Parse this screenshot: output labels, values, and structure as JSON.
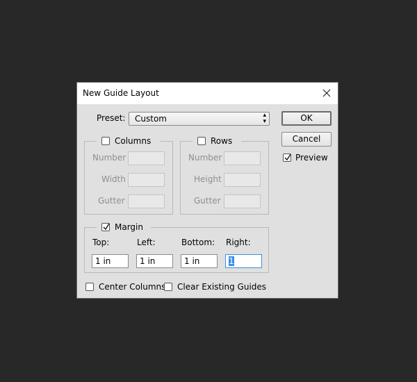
{
  "dialog": {
    "title": "New Guide Layout",
    "close_icon": "close-icon"
  },
  "preset": {
    "label": "Preset:",
    "value": "Custom"
  },
  "buttons": {
    "ok": "OK",
    "cancel": "Cancel"
  },
  "preview": {
    "label": "Preview",
    "checked": true
  },
  "columns": {
    "label": "Columns",
    "checked": false,
    "fields": [
      {
        "label": "Number",
        "value": ""
      },
      {
        "label": "Width",
        "value": ""
      },
      {
        "label": "Gutter",
        "value": ""
      }
    ]
  },
  "rows": {
    "label": "Rows",
    "checked": false,
    "fields": [
      {
        "label": "Number",
        "value": ""
      },
      {
        "label": "Height",
        "value": ""
      },
      {
        "label": "Gutter",
        "value": ""
      }
    ]
  },
  "margin": {
    "label": "Margin",
    "checked": true,
    "fields": [
      {
        "label": "Top:",
        "value": "1 in"
      },
      {
        "label": "Left:",
        "value": "1 in"
      },
      {
        "label": "Bottom:",
        "value": "1 in"
      },
      {
        "label": "Right:",
        "value": "1"
      }
    ]
  },
  "options": {
    "center_columns": {
      "label": "Center Columns",
      "checked": false
    },
    "clear_existing": {
      "label": "Clear Existing Guides",
      "checked": false
    }
  }
}
